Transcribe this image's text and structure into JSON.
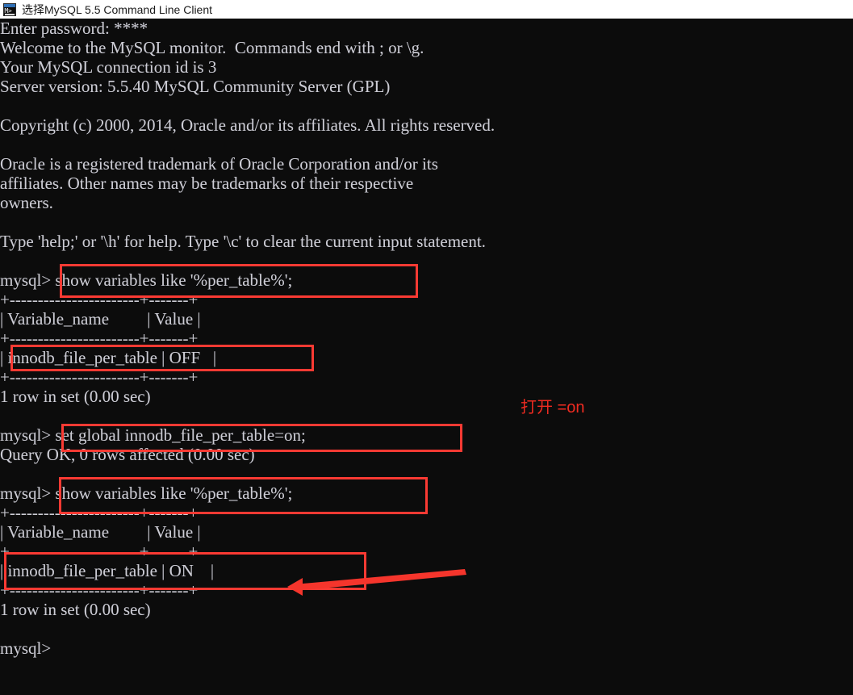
{
  "window": {
    "title": "选择MySQL 5.5 Command Line Client",
    "icon": "mysql-console-icon",
    "icon_glyph": "M&gt;_",
    "titlebar_bg": "#ffffff",
    "console_bg": "#0c0c0c",
    "console_fg": "#ccccd4"
  },
  "annotation": {
    "color": "#fa3a33",
    "note_text": "打开 =on",
    "note_color": "#ef2b21",
    "arrow": "left-pointing-arrow"
  },
  "console": {
    "lines": [
      "Enter password: ****",
      "Welcome to the MySQL monitor.  Commands end with ; or \\g.",
      "Your MySQL connection id is 3",
      "Server version: 5.5.40 MySQL Community Server (GPL)",
      "",
      "Copyright (c) 2000, 2014, Oracle and/or its affiliates. All rights reserved.",
      "",
      "Oracle is a registered trademark of Oracle Corporation and/or its",
      "affiliates. Other names may be trademarks of their respective",
      "owners.",
      "",
      "Type 'help;' or '\\h' for help. Type '\\c' to clear the current input statement.",
      "",
      "mysql> show variables like '%per_table%';",
      "+-----------------------+-------+",
      "| Variable_name         | Value |",
      "+-----------------------+-------+",
      "| innodb_file_per_table | OFF   |",
      "+-----------------------+-------+",
      "1 row in set (0.00 sec)",
      "",
      "mysql> set global innodb_file_per_table=on;",
      "Query OK, 0 rows affected (0.00 sec)",
      "",
      "mysql> show variables like '%per_table%';",
      "+-----------------------+-------+",
      "| Variable_name         | Value |",
      "+-----------------------+-------+",
      "| innodb_file_per_table | ON    |",
      "+-----------------------+-------+",
      "1 row in set (0.00 sec)",
      "",
      "mysql>"
    ],
    "prompt": "mysql>",
    "password_mask": "****",
    "mysql_version": "5.5.40",
    "connection_id": "3",
    "server_edition": "MySQL Community Server (GPL)",
    "commands": [
      "show variables like '%per_table%';",
      "set global innodb_file_per_table=on;",
      "show variables like '%per_table%';"
    ],
    "table": {
      "columns": [
        "Variable_name",
        "Value"
      ],
      "rows_before": [
        [
          "innodb_file_per_table",
          "OFF"
        ]
      ],
      "rows_after": [
        [
          "innodb_file_per_table",
          "ON"
        ]
      ],
      "result_status": "1 row in set (0.00 sec)",
      "update_status": "Query OK, 0 rows affected (0.00 sec)"
    }
  },
  "highlights": [
    {
      "name": "highlight-show-variables-1",
      "label": "show variables like '%per_table%';"
    },
    {
      "name": "highlight-result-off",
      "label": "| innodb_file_per_table | OFF   |"
    },
    {
      "name": "highlight-set-global",
      "label": "set global innodb_file_per_table=on;"
    },
    {
      "name": "highlight-show-variables-2",
      "label": "show variables like '%per_table%';"
    },
    {
      "name": "highlight-result-on",
      "label": "| innodb_file_per_table | ON    |"
    }
  ]
}
